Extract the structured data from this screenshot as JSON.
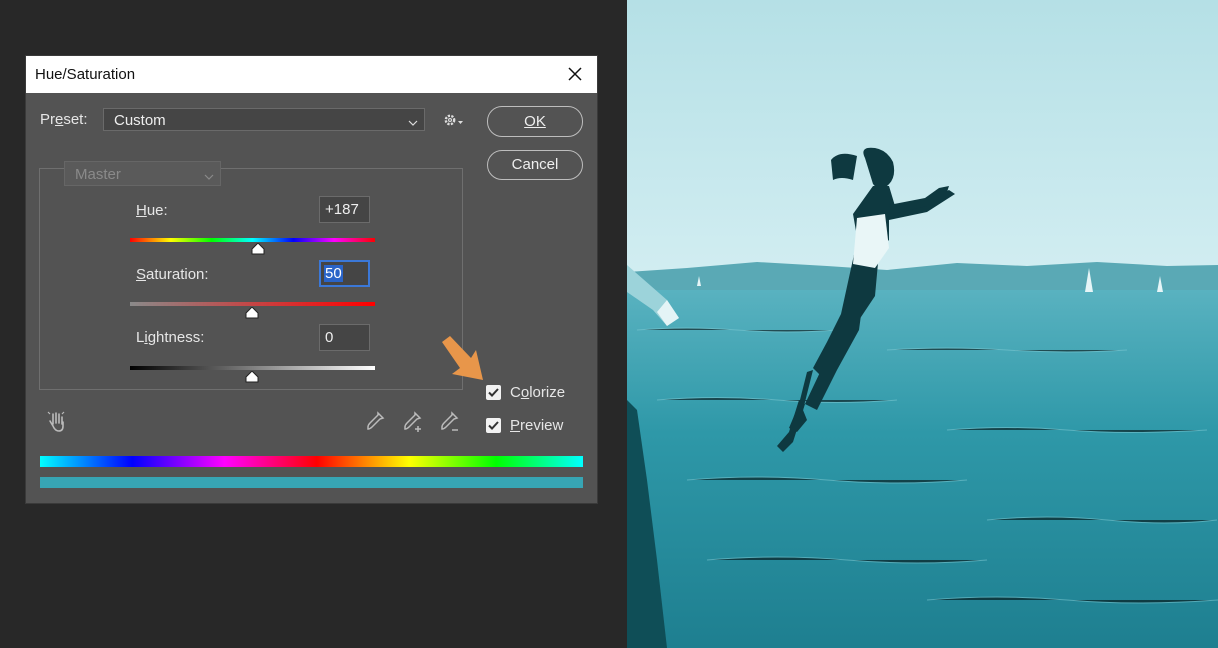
{
  "dialog": {
    "title": "Hue/Saturation",
    "preset": {
      "label": "Preset:",
      "value": "Custom"
    },
    "buttons": {
      "ok": "OK",
      "cancel": "Cancel"
    },
    "channel": "Master",
    "hue": {
      "label": "Hue:",
      "value": "+187",
      "level": 0.52
    },
    "saturation": {
      "label": "Saturation:",
      "value": "50",
      "level": 0.5
    },
    "lightness": {
      "label": "Lightness:",
      "value": "0",
      "level": 0.5
    },
    "colorize": {
      "label": "Colorize",
      "checked": true
    },
    "preview": {
      "label": "Preview",
      "checked": true
    }
  },
  "icons": [
    "close-icon",
    "gear-icon",
    "chevron-down-icon",
    "hand-target-icon",
    "eyedropper-icon",
    "eyedropper-plus-icon",
    "eyedropper-minus-icon",
    "checkmark-icon",
    "arrow-icon"
  ],
  "colors": {
    "panel": "#535353",
    "accent_arrow": "#e8964a",
    "tint": "#37a5b4"
  },
  "photo": {
    "description_hidden": true
  }
}
